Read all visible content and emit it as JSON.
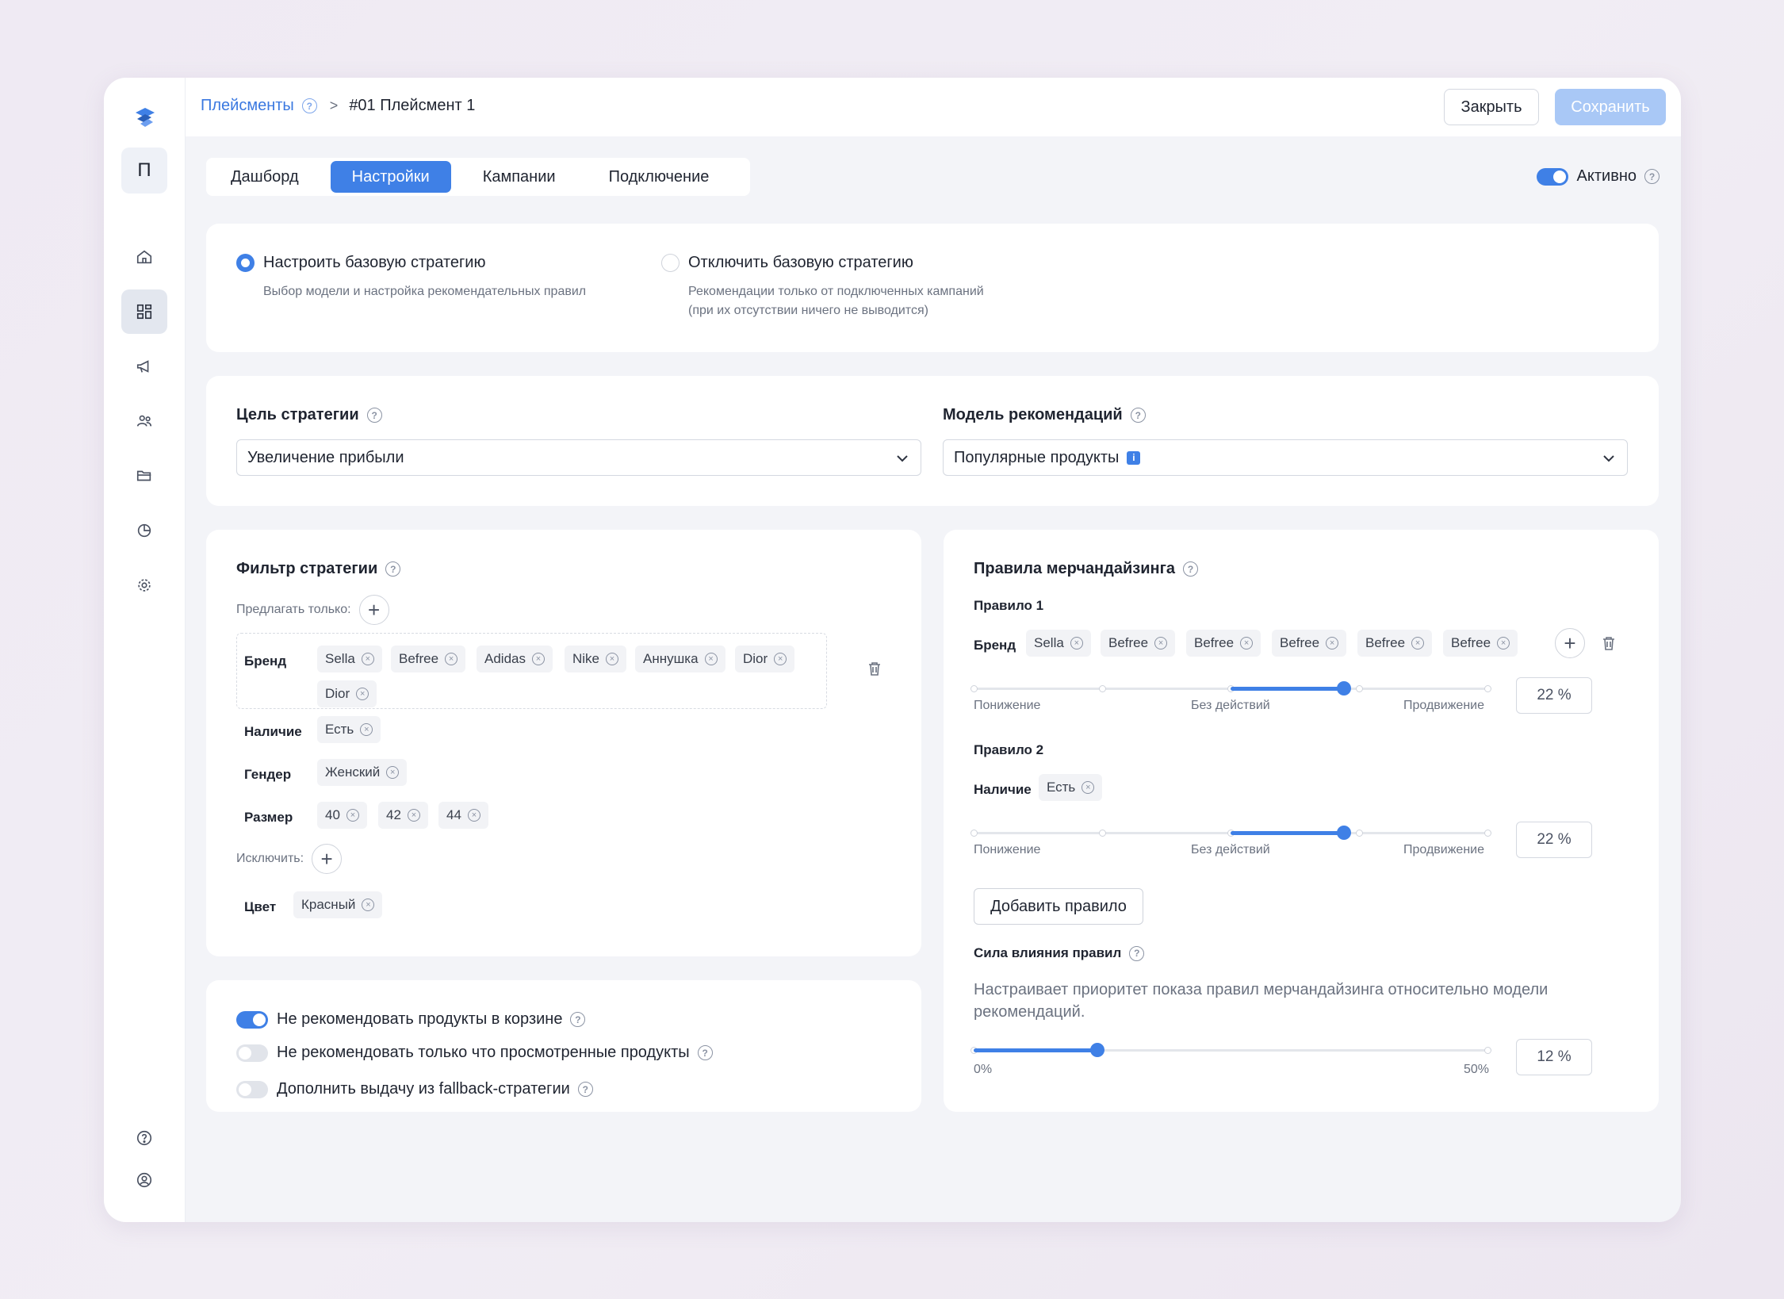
{
  "breadcrumb": {
    "parent": "Плейсменты",
    "current": "#01 Плейсмент 1"
  },
  "header": {
    "close_label": "Закрыть",
    "save_label": "Сохранить"
  },
  "sidebar": {
    "project_letter": "П",
    "items": [
      {
        "icon": "home-icon"
      },
      {
        "icon": "dashboard-icon",
        "active": true
      },
      {
        "icon": "megaphone-icon"
      },
      {
        "icon": "users-icon"
      },
      {
        "icon": "folder-icon"
      },
      {
        "icon": "pie-chart-icon"
      },
      {
        "icon": "gear-icon"
      }
    ],
    "bottom": [
      {
        "icon": "help-icon"
      },
      {
        "icon": "user-icon"
      }
    ]
  },
  "tabs": [
    {
      "label": "Дашборд",
      "active": false
    },
    {
      "label": "Настройки",
      "active": true
    },
    {
      "label": "Кампании",
      "active": false
    },
    {
      "label": "Подключение",
      "active": false
    }
  ],
  "status": {
    "label": "Активно",
    "on": true
  },
  "strategy": {
    "option1": {
      "title": "Настроить базовую стратегию",
      "desc": "Выбор модели и настройка рекомендательных правил",
      "selected": true
    },
    "option2": {
      "title": "Отключить базовую стратегию",
      "desc1": "Рекомендации только от подключенных кампаний",
      "desc2": "(при их отсутствии ничего не выводится)",
      "selected": false
    }
  },
  "goal": {
    "label": "Цель стратегии",
    "value": "Увеличение прибыли"
  },
  "model": {
    "label": "Модель рекомендаций",
    "value": "Популярные продукты"
  },
  "filter": {
    "title": "Фильтр стратегии",
    "offer_only": "Предлагать только:",
    "brand_label": "Бренд",
    "brands": [
      "Sella",
      "Befree",
      "Adidas",
      "Nike",
      "Аннушка",
      "Dior",
      "Dior"
    ],
    "availability_label": "Наличие",
    "availability": [
      "Есть"
    ],
    "gender_label": "Гендер",
    "gender": [
      "Женский"
    ],
    "size_label": "Размер",
    "sizes": [
      "40",
      "42",
      "44"
    ],
    "exclude": "Исключить:",
    "color_label": "Цвет",
    "colors": [
      "Красный"
    ]
  },
  "toggles": [
    {
      "label": "Не рекомендовать продукты в корзине",
      "on": true
    },
    {
      "label": "Не рекомендовать только что просмотренные продукты",
      "on": false
    },
    {
      "label": "Дополнить выдачу из fallback-стратегии",
      "on": false
    }
  ],
  "merch": {
    "title": "Правила мерчандайзинга",
    "rule1": {
      "title": "Правило 1",
      "label": "Бренд",
      "chips": [
        "Sella",
        "Befree",
        "Befree",
        "Befree",
        "Befree",
        "Befree"
      ],
      "value": "22 %",
      "fraction": 0.72
    },
    "rule2": {
      "title": "Правило 2",
      "label": "Наличие",
      "chips": [
        "Есть"
      ],
      "value": "22 %",
      "fraction": 0.72
    },
    "slider_labels": {
      "low": "Понижение",
      "mid": "Без действий",
      "high": "Продвижение"
    },
    "add_rule": "Добавить правило",
    "strength": {
      "title": "Сила влияния правил",
      "desc1": "Настраивает приоритет показа правил мерчандайзинга относительно модели",
      "desc2": "рекомендаций.",
      "min": "0%",
      "max": "50%",
      "value": "12 %",
      "fraction": 0.24
    }
  },
  "colors": {
    "accent": "#3f80e6",
    "link": "#3a78e0",
    "save_disabled": "#a9c8f6"
  }
}
